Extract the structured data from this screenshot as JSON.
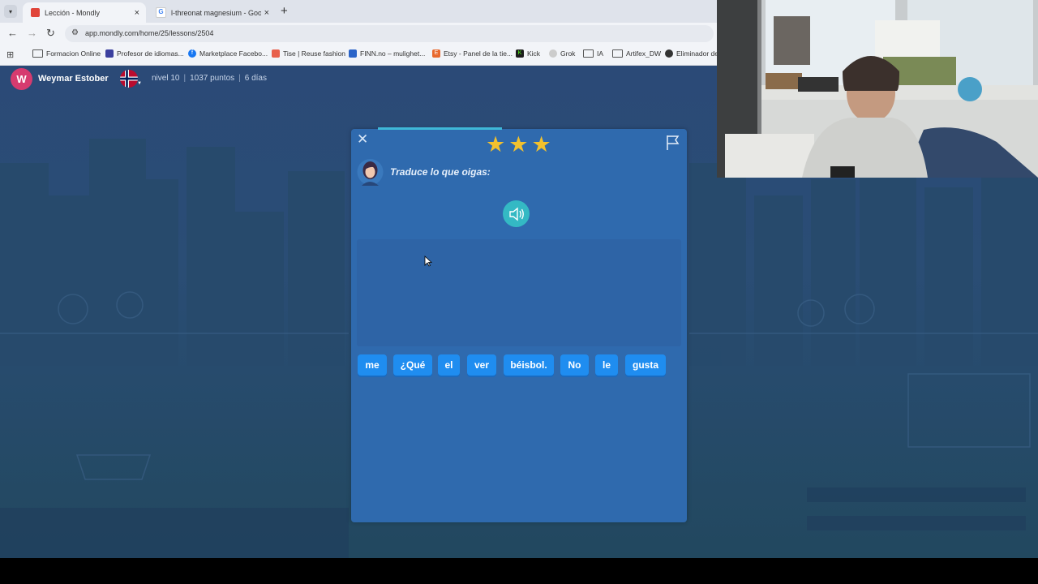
{
  "browser": {
    "tabs": [
      {
        "title": "Lección - Mondly",
        "close": "×"
      },
      {
        "title": "l-threonat magnesium - Google",
        "close": "×"
      }
    ],
    "newtab": "+",
    "url": "app.mondly.com/home/25/lessons/2504",
    "bookmarks": [
      "Formacion Online",
      "Profesor de idiomas...",
      "Marketplace Facebo...",
      "Tise | Reuse fashion",
      "FINN.no – mulighet...",
      "Etsy - Panel de la tie...",
      "Kick",
      "Grok",
      "IA",
      "Artifex_DW",
      "Eliminador de"
    ]
  },
  "topbar": {
    "avatar_letter": "W",
    "username": "Weymar Estober",
    "level": "nivel 10",
    "points": "1037 puntos",
    "streak": "6 días",
    "sep": "|"
  },
  "lesson": {
    "close": "✕",
    "stars": [
      "★",
      "★",
      "★"
    ],
    "prompt": "Traduce lo que oigas:",
    "progress": 0.37,
    "words": [
      "me",
      "¿Qué",
      "el",
      "ver",
      "béisbol.",
      "No",
      "le",
      "gusta"
    ]
  },
  "colors": {
    "accent": "#1f8df0",
    "card": "#2f6aae",
    "star": "#f2c12e",
    "audio": "#34b9c4",
    "avatar": "#d63b6f"
  }
}
